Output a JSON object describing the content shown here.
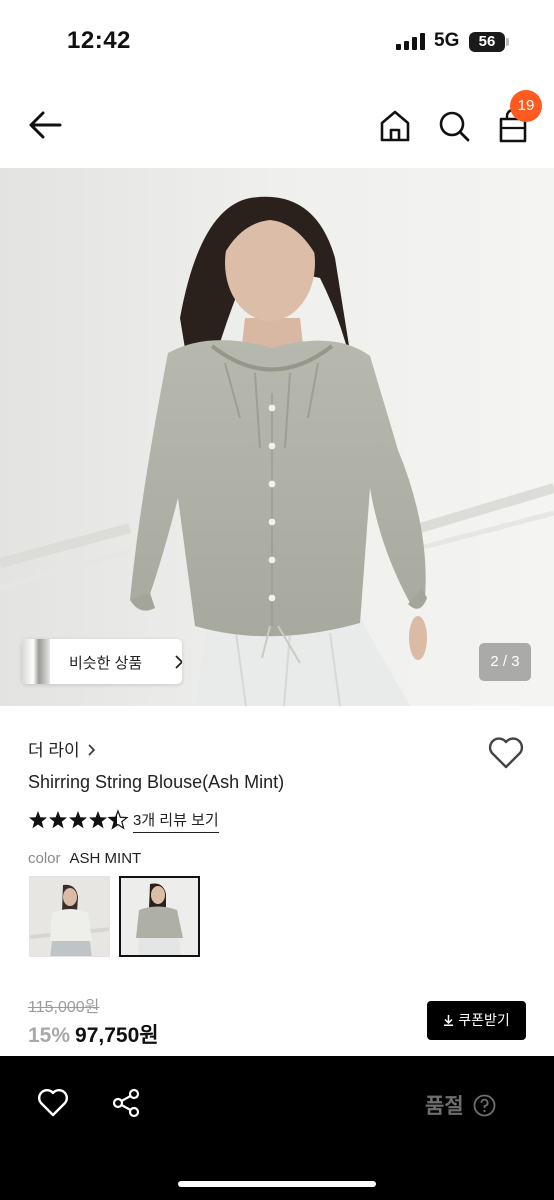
{
  "status_bar": {
    "time": "12:42",
    "network": "5G",
    "battery": "56"
  },
  "nav": {
    "cart_count": "19",
    "icons": [
      "back-arrow-icon",
      "home-icon",
      "search-icon",
      "shopping-bag-icon"
    ]
  },
  "gallery": {
    "similar_label": "비슷한 상품",
    "page_indicator": "2 / 3"
  },
  "product": {
    "brand": "더 라이",
    "name": "Shirring String Blouse(Ash Mint)",
    "rating": 4.5,
    "rating_max": 5,
    "review_link": "3개 리뷰 보기",
    "color_label": "color",
    "color_value": "ASH MINT",
    "original_price": "115,000원",
    "discount": "15%",
    "sale_price": "97,750원",
    "coupon_label": "쿠폰받기"
  },
  "bottom_bar": {
    "status": "품절"
  },
  "colors": {
    "badge": "#ff5a1f",
    "bottom_bar_bg": "#000000",
    "accent_text": "#111111"
  }
}
